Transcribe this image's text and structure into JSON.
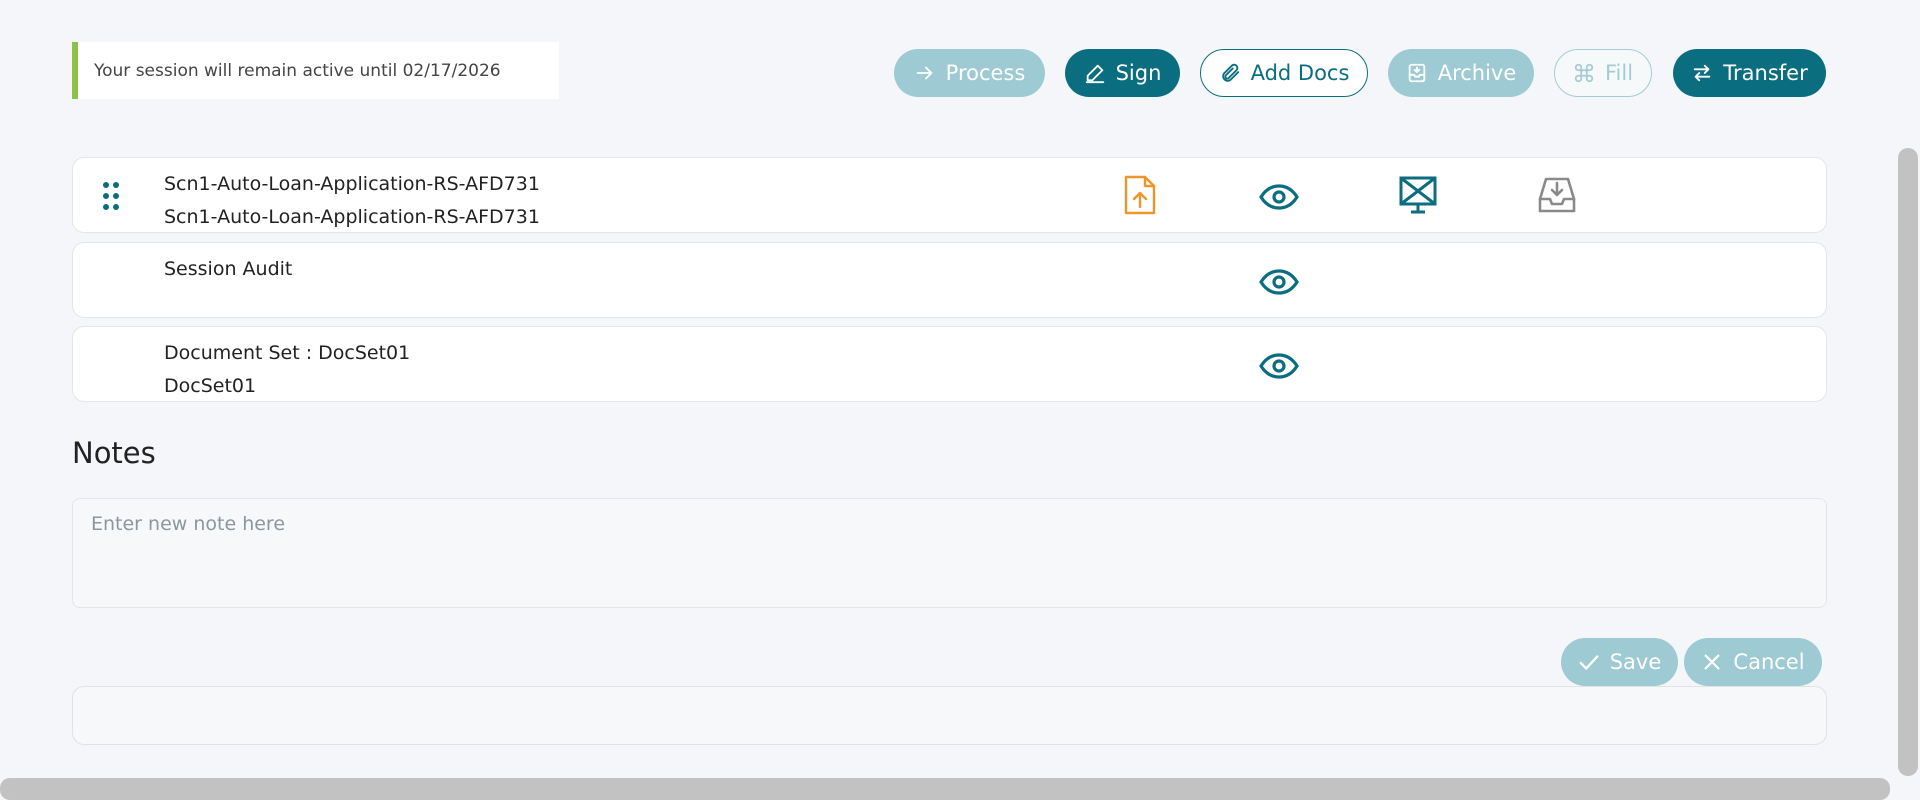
{
  "session": {
    "message": "Your session will remain active until 02/17/2026"
  },
  "toolbar": {
    "process": "Process",
    "sign": "Sign",
    "add_docs": "Add Docs",
    "archive": "Archive",
    "fill": "Fill",
    "transfer": "Transfer"
  },
  "documents": [
    {
      "title": "Scn1-Auto-Loan-Application-RS-AFD731",
      "subtitle": "Scn1-Auto-Loan-Application-RS-AFD731",
      "icons": [
        "upload-file-icon",
        "eye-icon",
        "monitor-icon",
        "inbox-download-icon"
      ]
    },
    {
      "title": "Session Audit",
      "subtitle": "",
      "icons": [
        "eye-icon"
      ]
    },
    {
      "title": "Document Set : DocSet01",
      "subtitle": "DocSet01",
      "icons": [
        "eye-icon"
      ]
    }
  ],
  "notes": {
    "title": "Notes",
    "placeholder": "Enter new note here",
    "save": "Save",
    "cancel": "Cancel"
  },
  "colors": {
    "primary": "#0b6e80",
    "primary_light": "#9ecad3",
    "session_accent": "#8bc34a",
    "upload_icon": "#f0952a",
    "inbox_icon": "#8a8a8a"
  }
}
